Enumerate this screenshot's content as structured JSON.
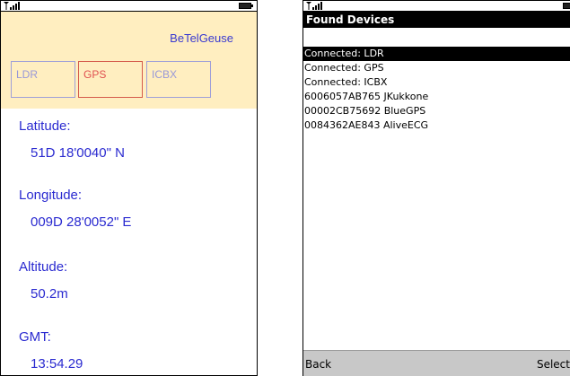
{
  "gps_screen": {
    "app_title": "BeTelGeuse",
    "devices": [
      "LDR",
      "GPS",
      "ICBX"
    ],
    "selected_device": "GPS",
    "fields": [
      {
        "label": "Latitude:",
        "value": "51D 18'0040\" N"
      },
      {
        "label": "Longitude:",
        "value": "009D 28'0052\" E"
      },
      {
        "label": "Altitude:",
        "value": "50.2m"
      },
      {
        "label": "GMT:",
        "value": "13:54.29"
      }
    ]
  },
  "devices_screen": {
    "title": "Found Devices",
    "items": [
      "Connected: LDR",
      "Connected: GPS",
      "Connected: ICBX",
      "6006057AB765 JKukkone",
      "00002CB75692 BlueGPS",
      "0084362AE843 AliveECG"
    ],
    "selected_index": 0,
    "softkeys": {
      "left": "Back",
      "right": "Select"
    }
  },
  "colors": {
    "header_bg": "#ffeec0",
    "text_blue": "#2a2ad0",
    "selected_border": "#d55a4a",
    "list_selected_bg": "#000000"
  },
  "icons": [
    "signal-icon",
    "battery-icon"
  ]
}
